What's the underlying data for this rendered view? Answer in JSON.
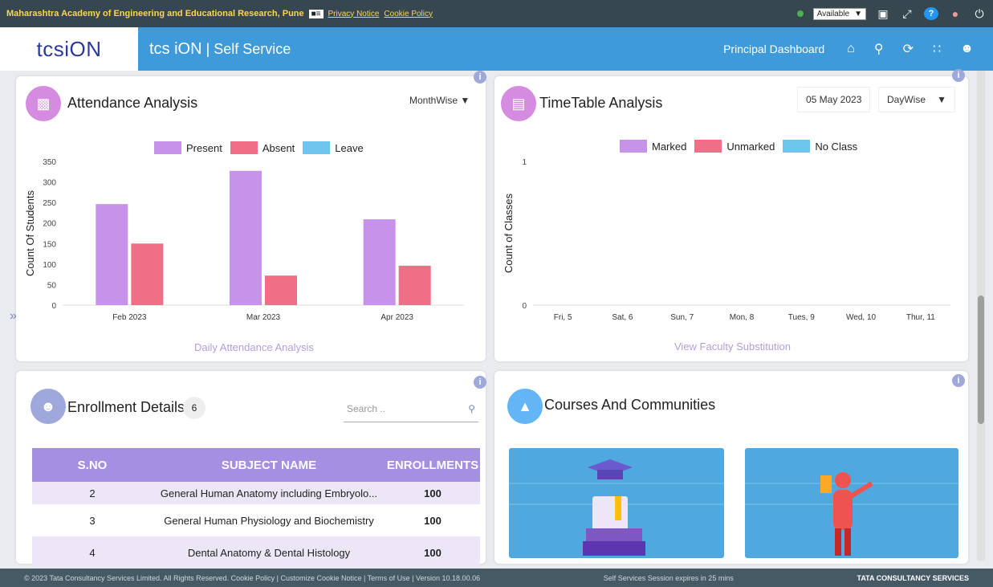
{
  "topbar": {
    "institution": "Maharashtra Academy of Engineering and Educational Research, Pune",
    "privacy": "Privacy Notice",
    "cookie": "Cookie Policy",
    "status": "Available",
    "status_color": "#4caf50"
  },
  "header": {
    "logo_left": "tcs",
    "logo_right": "iON",
    "app_name": "tcs iON",
    "app_suffix": " | Self Service",
    "dashboard": "Principal Dashboard",
    "bg_color": "#3e9ad8"
  },
  "attendance": {
    "title": "Attendance Analysis",
    "mode": "MonthWise",
    "ylabel": "Count Of Students",
    "footer": "Daily Attendance Analysis",
    "chart_data": {
      "type": "bar",
      "categories": [
        "Feb 2023",
        "Mar 2023",
        "Apr 2023"
      ],
      "series": [
        {
          "name": "Present",
          "values": [
            246,
            327,
            209
          ],
          "color": "#c792ea"
        },
        {
          "name": "Absent",
          "values": [
            150,
            72,
            96
          ],
          "color": "#f06f87"
        },
        {
          "name": "Leave",
          "values": [
            0,
            0,
            0
          ],
          "color": "#6ec6ef"
        }
      ],
      "ylim": [
        0,
        350
      ],
      "yticks": [
        0,
        50,
        100,
        150,
        200,
        250,
        300,
        350
      ]
    }
  },
  "timetable": {
    "title": "TimeTable Analysis",
    "date": "05 May 2023",
    "mode": "DayWise",
    "ylabel": "Count of Classes",
    "footer": "View Faculty Substitution",
    "chart_data": {
      "type": "bar",
      "categories": [
        "Fri, 5",
        "Sat, 6",
        "Sun, 7",
        "Mon, 8",
        "Tues, 9",
        "Wed, 10",
        "Thur, 11"
      ],
      "series": [
        {
          "name": "Marked",
          "values": [
            0,
            0,
            0,
            0,
            0,
            0,
            0
          ],
          "color": "#c792ea"
        },
        {
          "name": "Unmarked",
          "values": [
            0,
            0,
            0,
            0,
            0,
            0,
            0
          ],
          "color": "#f06f87"
        },
        {
          "name": "No Class",
          "values": [
            0,
            0,
            0,
            0,
            0,
            0,
            0
          ],
          "color": "#6ec6ef"
        }
      ],
      "ylim": [
        0,
        1
      ],
      "yticks": [
        0,
        1
      ]
    }
  },
  "enrollment": {
    "title": "Enrollment Details",
    "count": "6",
    "search_placeholder": "Search ..",
    "columns": [
      "S.NO",
      "SUBJECT NAME",
      "ENROLLMENTS"
    ],
    "rows": [
      {
        "sno": "2",
        "subject": "General Human Anatomy including Embryolo...",
        "enrollments": "100"
      },
      {
        "sno": "3",
        "subject": "General Human Physiology and Biochemistry",
        "enrollments": "100"
      },
      {
        "sno": "4",
        "subject": "Dental Anatomy & Dental Histology",
        "enrollments": "100"
      }
    ]
  },
  "courses": {
    "title": "Courses And Communities"
  },
  "bottombar": {
    "left": "© 2023 Tata Consultancy Services Limited. All Rights Reserved.   Cookie Policy | Customize Cookie Notice | Terms of Use | Version 10.18.00.06",
    "middle": "Self Services Session expires in 25 mins",
    "right": "TATA CONSULTANCY SERVICES"
  }
}
